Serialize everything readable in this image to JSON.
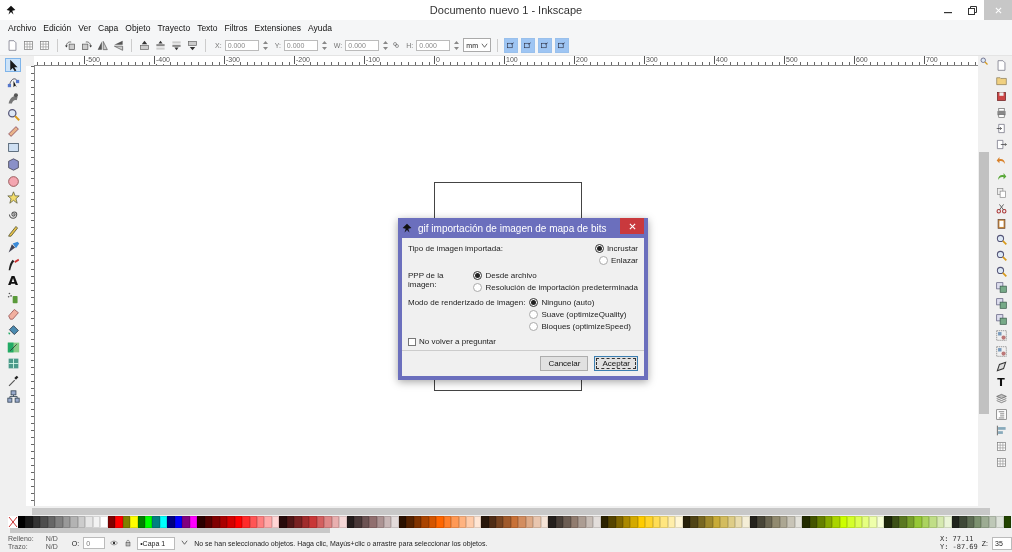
{
  "window": {
    "title": "Documento nuevo 1 - Inkscape"
  },
  "menu": [
    "Archivo",
    "Edición",
    "Ver",
    "Capa",
    "Objeto",
    "Trayecto",
    "Texto",
    "Filtros",
    "Extensiones",
    "Ayuda"
  ],
  "toolbar": {
    "groups": [
      [
        {
          "kind": "document"
        },
        {
          "kind": "grid"
        },
        {
          "kind": "grid"
        }
      ],
      [
        {
          "kind": "rotate-ccw"
        },
        {
          "kind": "rotate-cw"
        },
        {
          "kind": "flip-h"
        },
        {
          "kind": "flip-v"
        }
      ],
      [
        {
          "kind": "raise-top"
        },
        {
          "kind": "raise"
        },
        {
          "kind": "lower"
        },
        {
          "kind": "lower-bottom"
        }
      ]
    ],
    "fields": [
      {
        "label": "X:",
        "value": "0.000"
      },
      {
        "label": "Y:",
        "value": "0.000"
      },
      {
        "label": "W:",
        "value": "0.000"
      },
      {
        "label": "H:",
        "value": "0.000"
      }
    ],
    "unit": "mm",
    "toggles": [
      {
        "on": true
      },
      {
        "on": true
      },
      {
        "on": true
      },
      {
        "on": true
      }
    ]
  },
  "ruler": {
    "labels": [
      "-500",
      "-400",
      "-300",
      "-200",
      "-100",
      "0",
      "100",
      "200",
      "300",
      "400",
      "500",
      "600",
      "700"
    ]
  },
  "tools": [
    {
      "kind": "select",
      "selected": true
    },
    {
      "kind": "node",
      "selected": false
    },
    {
      "kind": "tweak",
      "selected": false
    },
    {
      "kind": "zoom",
      "selected": false
    },
    {
      "kind": "measure",
      "selected": false
    },
    {
      "kind": "rect",
      "selected": false
    },
    {
      "kind": "box3d",
      "selected": false
    },
    {
      "kind": "circle",
      "selected": false
    },
    {
      "kind": "star",
      "selected": false
    },
    {
      "kind": "spiral",
      "selected": false
    },
    {
      "kind": "pencil",
      "selected": false
    },
    {
      "kind": "pen",
      "selected": false
    },
    {
      "kind": "calligraphy",
      "selected": false
    },
    {
      "kind": "text",
      "glyph": "A",
      "selected": false
    },
    {
      "kind": "spray",
      "selected": false
    },
    {
      "kind": "eraser",
      "selected": false
    },
    {
      "kind": "bucket",
      "selected": false
    },
    {
      "kind": "gradient",
      "selected": false
    },
    {
      "kind": "mesh",
      "selected": false
    },
    {
      "kind": "dropper",
      "selected": false
    },
    {
      "kind": "connector",
      "selected": false
    }
  ],
  "commands": [
    {
      "kind": "document"
    },
    {
      "kind": "folder"
    },
    {
      "kind": "floppy"
    },
    {
      "kind": "printer"
    },
    {
      "kind": "import"
    },
    {
      "kind": "export"
    },
    {
      "kind": "undo"
    },
    {
      "kind": "redo"
    },
    {
      "kind": "copy"
    },
    {
      "kind": "scissors"
    },
    {
      "kind": "clipboard"
    },
    {
      "kind": "zoom"
    },
    {
      "kind": "zoom"
    },
    {
      "kind": "zoom"
    },
    {
      "kind": "duplicate"
    },
    {
      "kind": "duplicate"
    },
    {
      "kind": "duplicate"
    },
    {
      "kind": "group"
    },
    {
      "kind": "group"
    },
    {
      "kind": "fill"
    },
    {
      "kind": "text",
      "glyph": "T"
    },
    {
      "kind": "layers"
    },
    {
      "kind": "xml"
    },
    {
      "kind": "align"
    },
    {
      "kind": "grid"
    },
    {
      "kind": "grid"
    }
  ],
  "dialog": {
    "title": "gif importación de imagen de mapa de bits",
    "groups": [
      {
        "label": "Tipo de imagen importada:",
        "options": [
          {
            "label": "Incrustar",
            "selected": true
          },
          {
            "label": "Enlazar",
            "selected": false
          }
        ]
      },
      {
        "label": "PPP de la imagen:",
        "options": [
          {
            "label": "Desde archivo",
            "selected": true
          },
          {
            "label": "Resolución de importación predeterminada",
            "selected": false
          }
        ]
      },
      {
        "label": "Modo de renderizado de imagen:",
        "options": [
          {
            "label": "Ninguno (auto)",
            "selected": true
          },
          {
            "label": "Suave (optimizeQuality)",
            "selected": false
          },
          {
            "label": "Bloques (optimizeSpeed)",
            "selected": false
          }
        ]
      }
    ],
    "checkbox": {
      "label": "No volver a preguntar",
      "checked": false
    },
    "buttons": [
      {
        "label": "Cancelar",
        "default": false
      },
      {
        "label": "Aceptar",
        "default": true
      }
    ]
  },
  "palette": [
    {
      "color": "#000000"
    },
    {
      "color": "#1a1a1a"
    },
    {
      "color": "#333333"
    },
    {
      "color": "#4d4d4d"
    },
    {
      "color": "#666666"
    },
    {
      "color": "#808080"
    },
    {
      "color": "#999999"
    },
    {
      "color": "#b3b3b3"
    },
    {
      "color": "#cccccc"
    },
    {
      "color": "#e6e6e6"
    },
    {
      "color": "#f2f2f2"
    },
    {
      "color": "#ffffff"
    },
    {
      "color": "#800000"
    },
    {
      "color": "#ff0000"
    },
    {
      "color": "#808000"
    },
    {
      "color": "#ffff00"
    },
    {
      "color": "#008000"
    },
    {
      "color": "#00ff00"
    },
    {
      "color": "#008080"
    },
    {
      "color": "#00ffff"
    },
    {
      "color": "#000080"
    },
    {
      "color": "#0000ff"
    },
    {
      "color": "#800080"
    },
    {
      "color": "#ff00ff"
    },
    {
      "color": "#2b0000"
    },
    {
      "color": "#550000"
    },
    {
      "color": "#800001"
    },
    {
      "color": "#aa0000"
    },
    {
      "color": "#d40000"
    },
    {
      "color": "#ff0001"
    },
    {
      "color": "#ff2a2a"
    },
    {
      "color": "#ff5555"
    },
    {
      "color": "#ff8080"
    },
    {
      "color": "#ffaaaa"
    },
    {
      "color": "#ffd5d5"
    },
    {
      "color": "#280b0b"
    },
    {
      "color": "#501616"
    },
    {
      "color": "#782121"
    },
    {
      "color": "#a02c2c"
    },
    {
      "color": "#c83737"
    },
    {
      "color": "#d35f5f"
    },
    {
      "color": "#de8787"
    },
    {
      "color": "#e9afaf"
    },
    {
      "color": "#f4d7d7"
    },
    {
      "color": "#241c1c"
    },
    {
      "color": "#483737"
    },
    {
      "color": "#6c5353"
    },
    {
      "color": "#916f6f"
    },
    {
      "color": "#ac9393"
    },
    {
      "color": "#c8b7b7"
    },
    {
      "color": "#e3dbdb"
    },
    {
      "color": "#2b1100"
    },
    {
      "color": "#552200"
    },
    {
      "color": "#803300"
    },
    {
      "color": "#aa4400"
    },
    {
      "color": "#d45500"
    },
    {
      "color": "#ff6600"
    },
    {
      "color": "#ff7f2a"
    },
    {
      "color": "#ff9955"
    },
    {
      "color": "#ffb380"
    },
    {
      "color": "#ffccaa"
    },
    {
      "color": "#ffe6d5"
    },
    {
      "color": "#28170b"
    },
    {
      "color": "#502d16"
    },
    {
      "color": "#784421"
    },
    {
      "color": "#a05a2c"
    },
    {
      "color": "#c87137"
    },
    {
      "color": "#d38d5f"
    },
    {
      "color": "#deaa87"
    },
    {
      "color": "#e9c6af"
    },
    {
      "color": "#f4e3d7"
    },
    {
      "color": "#241f1c"
    },
    {
      "color": "#483e37"
    },
    {
      "color": "#6c5d53"
    },
    {
      "color": "#917c6f"
    },
    {
      "color": "#ac9d93"
    },
    {
      "color": "#c8beb7"
    },
    {
      "color": "#e3dedb"
    },
    {
      "color": "#2b2200"
    },
    {
      "color": "#554400"
    },
    {
      "color": "#806600"
    },
    {
      "color": "#aa8800"
    },
    {
      "color": "#d4aa00"
    },
    {
      "color": "#ffcc00"
    },
    {
      "color": "#ffd42a"
    },
    {
      "color": "#ffdd55"
    },
    {
      "color": "#ffe680"
    },
    {
      "color": "#ffeeaa"
    },
    {
      "color": "#fff6d5"
    },
    {
      "color": "#28220b"
    },
    {
      "color": "#504416"
    },
    {
      "color": "#786721"
    },
    {
      "color": "#a0892c"
    },
    {
      "color": "#c8ab37"
    },
    {
      "color": "#d3bc5f"
    },
    {
      "color": "#decd87"
    },
    {
      "color": "#e9ddaf"
    },
    {
      "color": "#f4eed7"
    },
    {
      "color": "#24221c"
    },
    {
      "color": "#484537"
    },
    {
      "color": "#6c6753"
    },
    {
      "color": "#918a6f"
    },
    {
      "color": "#aca793"
    },
    {
      "color": "#c8c4b7"
    },
    {
      "color": "#e3e2db"
    },
    {
      "color": "#222b00"
    },
    {
      "color": "#445500"
    },
    {
      "color": "#668000"
    },
    {
      "color": "#88aa00"
    },
    {
      "color": "#aad400"
    },
    {
      "color": "#ccff00"
    },
    {
      "color": "#d4ff2a"
    },
    {
      "color": "#ddff55"
    },
    {
      "color": "#e5ff80"
    },
    {
      "color": "#eeffaa"
    },
    {
      "color": "#f6ffd5"
    },
    {
      "color": "#1e280b"
    },
    {
      "color": "#3c5016"
    },
    {
      "color": "#5a7821"
    },
    {
      "color": "#78a02c"
    },
    {
      "color": "#96c837"
    },
    {
      "color": "#abd35f"
    },
    {
      "color": "#c0de87"
    },
    {
      "color": "#d5e9af"
    },
    {
      "color": "#eaf4d7"
    },
    {
      "color": "#1f241c"
    },
    {
      "color": "#3e4837"
    },
    {
      "color": "#5d6c53"
    },
    {
      "color": "#7c916f"
    },
    {
      "color": "#9dac93"
    },
    {
      "color": "#bec8b7"
    },
    {
      "color": "#dee3db"
    },
    {
      "color": "#224400"
    }
  ],
  "status": {
    "fill_label": "Relleno:",
    "fill_value": "N/D",
    "stroke_label": "Trazo:",
    "stroke_value": "N/D",
    "opacity_label": "O:",
    "opacity_value": "0",
    "layer": "•Capa 1",
    "message": "No se han seleccionado objetos. Haga clic, Mayús+clic o arrastre para seleccionar los objetos.",
    "x_label": "X:",
    "x_value": "77.11",
    "y_label": "Y:",
    "y_value": "-87.69",
    "zoom_label": "Z:",
    "zoom_value": "35"
  }
}
